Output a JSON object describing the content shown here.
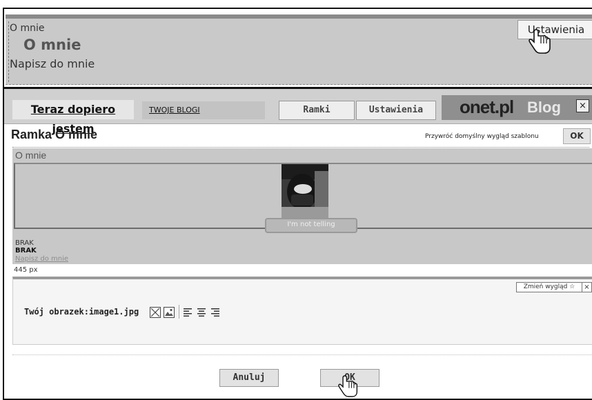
{
  "top_preview": {
    "frame_label": "O mnie",
    "heading": "O mnie",
    "write_link": "Napisz do mnie",
    "settings_button": "Ustawienia"
  },
  "header": {
    "blog_title": "Teraz dopiero jestem",
    "your_blogs_link": "TWOJE BLOGI",
    "frames_button": "Ramki",
    "settings_button": "Ustawienia",
    "logo_onet": "onet.pl",
    "logo_blog": "Blog",
    "close_label": "×"
  },
  "page": {
    "title": "Ramka O mnie",
    "restore_text": "Przywróć domyślny wygląd szablonu",
    "restore_ok": "OK"
  },
  "preview": {
    "frame_label": "O mnie",
    "image_caption": "I'm not telling",
    "line1": "BRAK",
    "line2": "BRAK",
    "write_link": "Napisz do mnie",
    "width_label": "445 px"
  },
  "settings": {
    "change_look": "Zmień wygląd ☆",
    "close_label": "×",
    "image_label": "Twój obrazek:image1.jpg",
    "tools": [
      "delete-icon",
      "image-icon",
      "align-left-icon",
      "align-center-icon",
      "align-right-icon"
    ]
  },
  "footer": {
    "cancel_button": "Anuluj",
    "ok_button": "OK"
  },
  "colors": {
    "panel_gray": "#c8c8c8",
    "topbar_gray": "#d0d0d0",
    "logo_bg": "#8f8f8f"
  }
}
